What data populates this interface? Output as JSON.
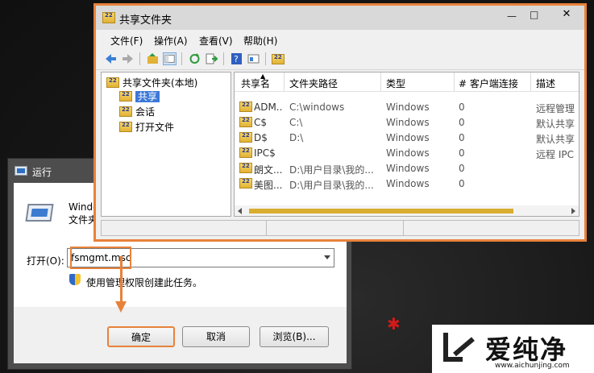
{
  "run_dialog": {
    "title": "运行",
    "desc_line1": "Window",
    "desc_line2": "文件夹、",
    "open_label": "打开(O):",
    "open_value": "fsmgmt.msc",
    "admin_note": "使用管理权限创建此任务。",
    "ok_label": "确定",
    "cancel_label": "取消",
    "browse_label": "浏览(B)..."
  },
  "mmc": {
    "title": "共享文件夹",
    "menu": [
      "文件(F)",
      "操作(A)",
      "查看(V)",
      "帮助(H)"
    ],
    "tree": {
      "root": "共享文件夹(本地)",
      "items": [
        "共享",
        "会话",
        "打开文件"
      ]
    },
    "columns": [
      "共享名",
      "文件夹路径",
      "类型",
      "# 客户端连接",
      "描述"
    ],
    "rows": [
      {
        "name": "ADM...",
        "path": "C:\\windows",
        "type": "Windows",
        "clients": "0",
        "desc": "远程管理"
      },
      {
        "name": "C$",
        "path": "C:\\",
        "type": "Windows",
        "clients": "0",
        "desc": "默认共享"
      },
      {
        "name": "D$",
        "path": "D:\\",
        "type": "Windows",
        "clients": "0",
        "desc": "默认共享"
      },
      {
        "name": "IPC$",
        "path": "",
        "type": "Windows",
        "clients": "0",
        "desc": "远程 IPC"
      },
      {
        "name": "朗文...",
        "path": "D:\\用户目录\\我的...",
        "type": "Windows",
        "clients": "0",
        "desc": ""
      },
      {
        "name": "美图...",
        "path": "D:\\用户目录\\我的...",
        "type": "Windows",
        "clients": "0",
        "desc": ""
      }
    ]
  },
  "watermark": {
    "name": "爱纯净",
    "url": "www.aichunjing.com"
  },
  "colors": {
    "highlight": "#e8823a",
    "selection": "#3c78d8",
    "scroll_thumb": "#d9ad2f"
  }
}
